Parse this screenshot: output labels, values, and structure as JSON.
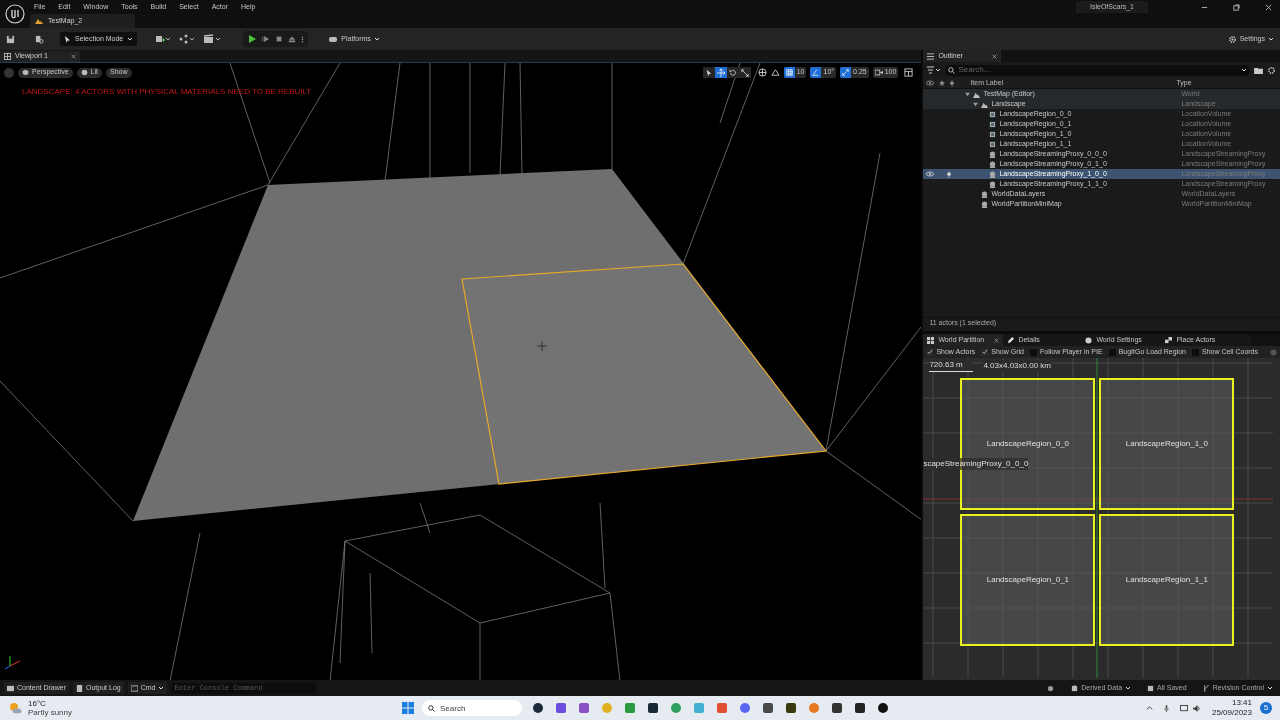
{
  "app": {
    "menu": [
      "File",
      "Edit",
      "Window",
      "Tools",
      "Build",
      "Select",
      "Actor",
      "Help"
    ],
    "project": "IsleOfScars_1",
    "document_tab": "TestMap_2"
  },
  "toolbar": {
    "mode": "Selection Mode",
    "platforms": "Platforms",
    "settings": "Settings"
  },
  "viewport": {
    "tab": "Viewport 1",
    "view_buttons": [
      "Perspective",
      "Lit",
      "Show"
    ],
    "warning": "LANDSCAPE: 4 ACTORS WITH PHYSICAL MATERIALS NEED TO BE REBUILT",
    "tools": [
      {
        "kind": "select",
        "selected": false
      },
      {
        "kind": "move",
        "selected": true
      },
      {
        "kind": "rotate",
        "selected": false
      },
      {
        "kind": "scale",
        "selected": false
      }
    ],
    "snaps": [
      {
        "kind": "grid",
        "label": "10",
        "on": true
      },
      {
        "kind": "angle",
        "label": "10°",
        "on": true
      },
      {
        "kind": "scale",
        "label": "0.25",
        "on": true
      }
    ],
    "camera_speed": "100"
  },
  "outliner": {
    "tab": "Outliner",
    "search_placeholder": "Search...",
    "columns": [
      "Item Label",
      "Type"
    ],
    "rows": [
      {
        "label": "TestMap (Editor)",
        "type": "World",
        "kind": "world",
        "selected": false,
        "expanded": true,
        "children": [
          {
            "label": "Landscape",
            "type": "Landscape",
            "kind": "landscape",
            "selected": false,
            "expanded": true,
            "children": [
              {
                "label": "LandscapeRegion_0_0",
                "type": "LocationVolume",
                "kind": "volume",
                "selected": false
              },
              {
                "label": "LandscapeRegion_0_1",
                "type": "LocationVolume",
                "kind": "volume",
                "selected": false
              },
              {
                "label": "LandscapeRegion_1_0",
                "type": "LocationVolume",
                "kind": "volume",
                "selected": false
              },
              {
                "label": "LandscapeRegion_1_1",
                "type": "LocationVolume",
                "kind": "volume",
                "selected": false
              },
              {
                "label": "LandscapeStreamingProxy_0_0_0",
                "type": "LandscapeStreamingProxy",
                "kind": "actor",
                "selected": false
              },
              {
                "label": "LandscapeStreamingProxy_0_1_0",
                "type": "LandscapeStreamingProxy",
                "kind": "actor",
                "selected": false
              },
              {
                "label": "LandscapeStreamingProxy_1_0_0",
                "type": "LandscapeStreamingProxy",
                "kind": "actor",
                "selected": true
              },
              {
                "label": "LandscapeStreamingProxy_1_1_0",
                "type": "LandscapeStreamingProxy",
                "kind": "actor",
                "selected": false
              }
            ]
          },
          {
            "label": "WorldDataLayers",
            "type": "WorldDataLayers",
            "kind": "actor",
            "selected": false
          },
          {
            "label": "WorldPartitionMiniMap",
            "type": "WorldPartitionMiniMap",
            "kind": "actor",
            "selected": false
          }
        ]
      }
    ],
    "summary": "11 actors (1 selected)"
  },
  "world_partition": {
    "tabs": [
      {
        "label": "World Partition",
        "kind": "partition",
        "selected": true
      },
      {
        "label": "Details",
        "kind": "details",
        "selected": false
      },
      {
        "label": "World Settings",
        "kind": "globe",
        "selected": false
      },
      {
        "label": "Place Actors",
        "kind": "place",
        "selected": false
      }
    ],
    "options": [
      {
        "label": "Show Actors",
        "checked": true
      },
      {
        "label": "Show Grid",
        "checked": true
      },
      {
        "label": "Follow Player in PIE",
        "checked": false
      },
      {
        "label": "BugItGo Load Region",
        "checked": false
      },
      {
        "label": "Show Cell Coords",
        "checked": false
      }
    ],
    "scale": "720.63 m",
    "size": "4.03x4.03x0.00 km",
    "proxy_label": "scapeStreamingProxy_0_0_0",
    "cells": [
      "LandscapeRegion_0_0",
      "LandscapeRegion_1_0",
      "LandscapeRegion_0_1",
      "LandscapeRegion_1_1"
    ]
  },
  "status_bar": {
    "items": [
      "Content Drawer",
      "Output Log",
      "Cmd"
    ],
    "console_placeholder": "Enter Console Command",
    "right": [
      "Derived Data",
      "All Saved",
      "Revision Control"
    ]
  },
  "taskbar": {
    "temperature": "16°C",
    "weather": "Partly sunny",
    "search_placeholder": "Search",
    "time": "13:41",
    "date": "25/09/2023",
    "notification_count": "5"
  }
}
